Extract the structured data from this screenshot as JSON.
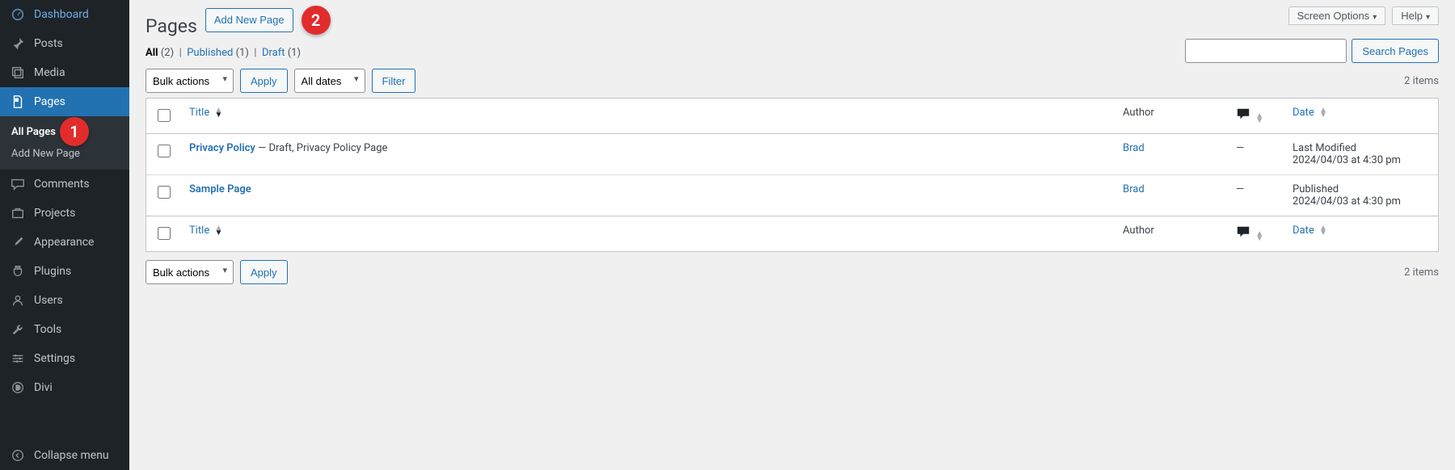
{
  "sidebar": {
    "items": [
      {
        "label": "Dashboard",
        "icon": "gauge"
      },
      {
        "label": "Posts",
        "icon": "pin"
      },
      {
        "label": "Media",
        "icon": "media"
      },
      {
        "label": "Pages",
        "icon": "page",
        "current": true
      },
      {
        "label": "Comments",
        "icon": "comment"
      },
      {
        "label": "Projects",
        "icon": "portfolio"
      },
      {
        "label": "Appearance",
        "icon": "brush"
      },
      {
        "label": "Plugins",
        "icon": "plug"
      },
      {
        "label": "Users",
        "icon": "user"
      },
      {
        "label": "Tools",
        "icon": "wrench"
      },
      {
        "label": "Settings",
        "icon": "sliders"
      },
      {
        "label": "Divi",
        "icon": "divi"
      }
    ],
    "submenu": [
      {
        "label": "All Pages",
        "current": true
      },
      {
        "label": "Add New Page"
      }
    ],
    "collapse": "Collapse menu",
    "badge_submenu": "1"
  },
  "top": {
    "screen_options": "Screen Options",
    "help": "Help"
  },
  "header": {
    "title": "Pages",
    "add_new": "Add New Page",
    "badge": "2"
  },
  "filters": {
    "all_label": "All",
    "all_count": "(2)",
    "published_label": "Published",
    "published_count": "(1)",
    "draft_label": "Draft",
    "draft_count": "(1)"
  },
  "bulk": {
    "select": "Bulk actions",
    "apply": "Apply"
  },
  "dates": {
    "select": "All dates",
    "filter": "Filter"
  },
  "search": {
    "placeholder": "",
    "button": "Search Pages"
  },
  "paging": {
    "items": "2 items"
  },
  "columns": {
    "title": "Title",
    "author": "Author",
    "date": "Date"
  },
  "rows": [
    {
      "title": "Privacy Policy",
      "suffix": " — Draft, Privacy Policy Page",
      "author": "Brad",
      "comments": "—",
      "date_l1": "Last Modified",
      "date_l2": "2024/04/03 at 4:30 pm"
    },
    {
      "title": "Sample Page",
      "suffix": "",
      "author": "Brad",
      "comments": "—",
      "date_l1": "Published",
      "date_l2": "2024/04/03 at 4:30 pm"
    }
  ]
}
